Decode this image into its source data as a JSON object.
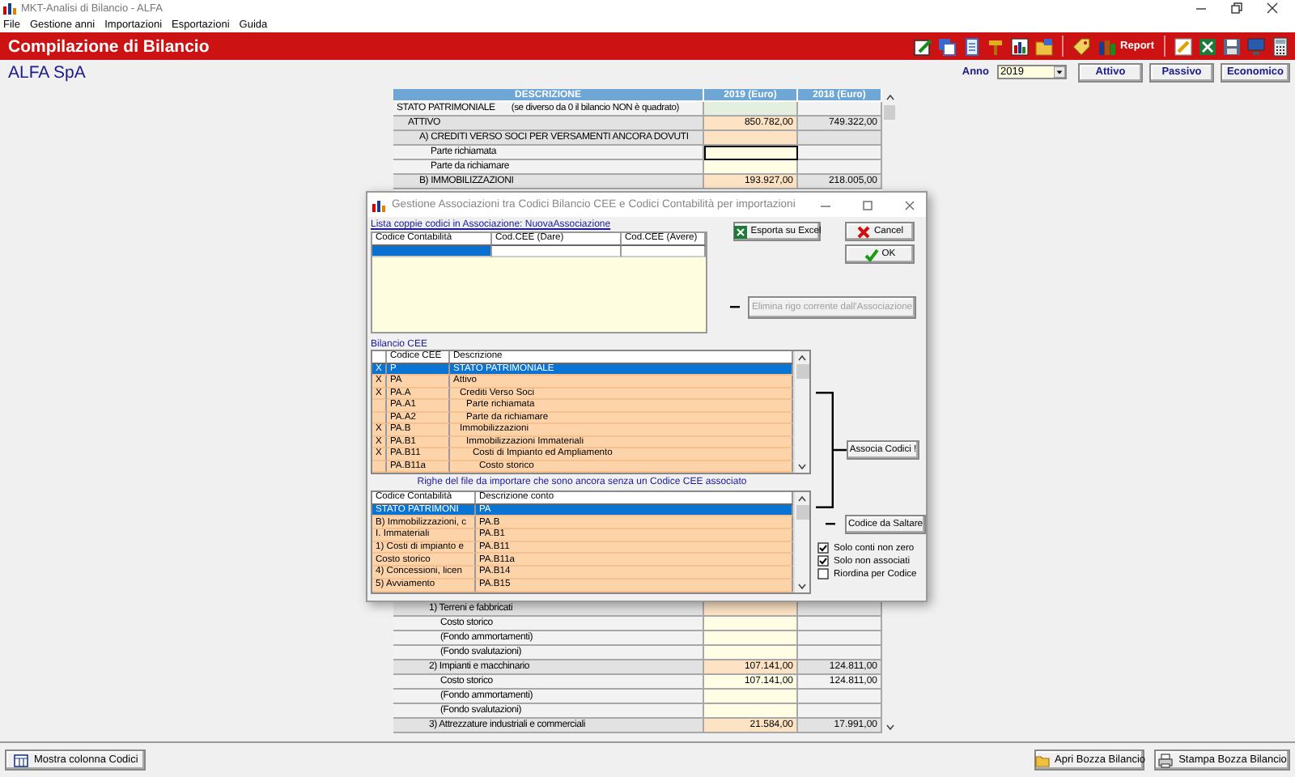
{
  "app_window": {
    "title": "MKT-Analisi di Bilancio - ALFA"
  },
  "menu": [
    "File",
    "Gestione anni",
    "Importazioni",
    "Esportazioni",
    "Guida"
  ],
  "header": {
    "title": "Compilazione di Bilancio",
    "report_button": "Report"
  },
  "company": {
    "name": "ALFA SpA",
    "year_label": "Anno",
    "year": "2019",
    "buttons": [
      "Attivo",
      "Passivo",
      "Economico"
    ]
  },
  "balance_table": {
    "columns": [
      "DESCRIZIONE",
      "2019 (Euro)",
      "2018 (Euro)"
    ],
    "row_groups": [
      {
        "rows": [
          {
            "kind": "root",
            "label": "STATO PATRIMONIALE",
            "note": "(se diverso da 0 il bilancio NON è quadrato)",
            "focused": false,
            "children": [
              {
                "kind": "total",
                "label": "ATTIVO",
                "current": "850.782,00",
                "previous": "749.322,00",
                "focused": false,
                "children": [
                  {
                    "kind": "total",
                    "label": "A) CREDITI VERSO SOCI PER VERSAMENTI ANCORA DOVUTI",
                    "focused": false,
                    "children": [
                      {
                        "kind": "input",
                        "label": "Parte richiamata",
                        "focused": true
                      },
                      {
                        "kind": "input",
                        "label": "Parte da richiamare",
                        "focused": false
                      }
                    ]
                  },
                  {
                    "kind": "total",
                    "label": "B) IMMOBILIZZAZIONI",
                    "current": "193.927,00",
                    "previous": "218.005,00",
                    "focused": false
                  }
                ]
              }
            ]
          }
        ]
      },
      {
        "rows": [
          {
            "kind": "total",
            "label": "1) Terreni e fabbricati",
            "focused": false,
            "children": [
              {
                "kind": "input",
                "label": "Costo storico",
                "focused": false
              },
              {
                "kind": "input",
                "label": "(Fondo ammortamenti)",
                "focused": false
              },
              {
                "kind": "input",
                "label": "(Fondo svalutazioni)",
                "focused": false
              }
            ]
          },
          {
            "kind": "total",
            "label": "2) Impianti e macchinario",
            "current": "107.141,00",
            "previous": "124.811,00",
            "focused": false,
            "children": [
              {
                "kind": "input",
                "label": "Costo storico",
                "current": "107.141,00",
                "previous": "124.811,00",
                "focused": false
              },
              {
                "kind": "input",
                "label": "(Fondo ammortamenti)",
                "focused": false
              },
              {
                "kind": "input",
                "label": "(Fondo svalutazioni)",
                "focused": false
              }
            ]
          },
          {
            "kind": "total",
            "label": "3) Attrezzature industriali e commerciali",
            "current": "21.584,00",
            "previous": "17.991,00",
            "focused": false
          }
        ]
      }
    ]
  },
  "dialog": {
    "title": "Gestione Associazioni tra Codici Bilancio CEE e Codici Contabilità per importazioni",
    "associations": {
      "label": "Lista coppie codici in Associazione: NuovaAssociazione",
      "columns": [
        "Codice Contabilità",
        "Cod.CEE (Dare)",
        "Cod.CEE (Avere)"
      ],
      "rows": [
        {
          "selected": true
        }
      ]
    },
    "export_button": "Esporta su Excel",
    "cancel_button": "Cancel",
    "ok_button": "OK",
    "delete_button": {
      "label": "Elimina rigo corrente dall'Associazione",
      "disabled": true
    },
    "cee": {
      "label": "Bilancio CEE",
      "columns": [
        "Codice CEE",
        "Descrizione"
      ],
      "rows": [
        {
          "mark": "X",
          "code": "P",
          "description": "STATO PATRIMONIALE",
          "selected": true
        },
        {
          "mark": "X",
          "code": "PA",
          "description": "Attivo",
          "selected": false,
          "children": [
            {
              "mark": "X",
              "code": "PA.A",
              "description": "Crediti Verso Soci",
              "selected": false,
              "children": [
                {
                  "code": "PA.A1",
                  "description": "Parte richiamata",
                  "selected": false
                },
                {
                  "code": "PA.A2",
                  "description": "Parte da richiamare",
                  "selected": false
                }
              ]
            },
            {
              "mark": "X",
              "code": "PA.B",
              "description": "Immobilizzazioni",
              "selected": false,
              "children": [
                {
                  "mark": "X",
                  "code": "PA.B1",
                  "description": "Immobilizzazioni Immateriali",
                  "selected": false,
                  "children": [
                    {
                      "mark": "X",
                      "code": "PA.B11",
                      "description": "Costi di Impianto ed Ampliamento",
                      "selected": false,
                      "children": [
                        {
                          "code": "PA.B11a",
                          "description": "Costo storico",
                          "selected": false
                        }
                      ]
                    }
                  ]
                }
              ]
            }
          ]
        }
      ]
    },
    "associate_button": "Associa Codici !",
    "pending": {
      "label": "Righe del file da importare che sono ancora senza un Codice CEE associato",
      "columns": [
        "Codice Contabilità",
        "Descrizione conto"
      ],
      "rows": [
        {
          "account": "STATO PATRIMONI",
          "description": "PA",
          "selected": true
        },
        {
          "account": "B) Immobilizzazioni, c",
          "description": "PA.B",
          "selected": false
        },
        {
          "account": "I. Immateriali",
          "description": "PA.B1",
          "selected": false
        },
        {
          "account": "1) Costi di impianto e",
          "description": "PA.B11",
          "selected": false
        },
        {
          "account": "Costo storico",
          "description": "PA.B11a",
          "selected": false
        },
        {
          "account": "4) Concessioni, licen",
          "description": "PA.B14",
          "selected": false
        },
        {
          "account": "5) Avviamento",
          "description": "PA.B15",
          "selected": false
        }
      ]
    },
    "skip_button": "Codice da Saltare",
    "options": [
      {
        "label": "Solo conti non zero",
        "checked": true
      },
      {
        "label": "Solo non associati",
        "checked": true
      },
      {
        "label": "Riordina per Codice",
        "checked": false
      }
    ]
  },
  "footer": {
    "left_buttons": [
      {
        "kind": "columns",
        "label": "Mostra colonna Codici"
      }
    ],
    "right_buttons": [
      {
        "kind": "open",
        "label": "Apri Bozza Bilancio"
      },
      {
        "kind": "print",
        "label": "Stampa Bozza Bilancio"
      }
    ]
  }
}
